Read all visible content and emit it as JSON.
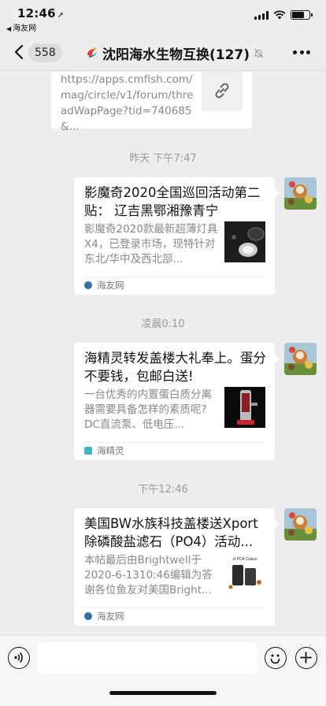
{
  "status_bar": {
    "time": "12:46",
    "back_app": "海友网"
  },
  "nav": {
    "unread_count": "558",
    "title": "沈阳海水生物互换(127)"
  },
  "url_message": {
    "text": "https://apps.cmfish.com/mag/circle/v1/forum/threadWapPage?tid=740685&..."
  },
  "timestamps": [
    "昨天 下午7:47",
    "凌晨0:10",
    "下午12:46"
  ],
  "messages": [
    {
      "title": "影魔奇2020全国巡回活动第二贴： 辽吉黑鄂湘豫青宁",
      "desc": "影魔奇2020款最新超薄灯具X4，已登录市场，现特针对东北/华中及西北部...",
      "source": "海友网",
      "source_color": "#2f6fa8",
      "thumb_icon": "aquarium-light-icon"
    },
    {
      "title": "海精灵转发盖楼大礼奉上。蛋分不要钱，包邮白送!",
      "desc": "一台优秀的内置蛋白质分离器需要具备怎样的素质呢? DC直流泵、低电压...",
      "source": "海精灵",
      "source_color": "#3cb6c9",
      "thumb_icon": "protein-skimmer-icon"
    },
    {
      "title": "美国BW水族科技盖楼送Xport除磷酸盐滤石（PO4）活动...",
      "desc": "本帖最后由Brightwell于2020-6-1310:46编辑为答谢各位鱼友对美国Bright...",
      "source": "海友网",
      "source_color": "#2f6fa8",
      "thumb_icon": "product-bottle-icon",
      "thumb_text": "xt PO4 Cubes"
    }
  ]
}
